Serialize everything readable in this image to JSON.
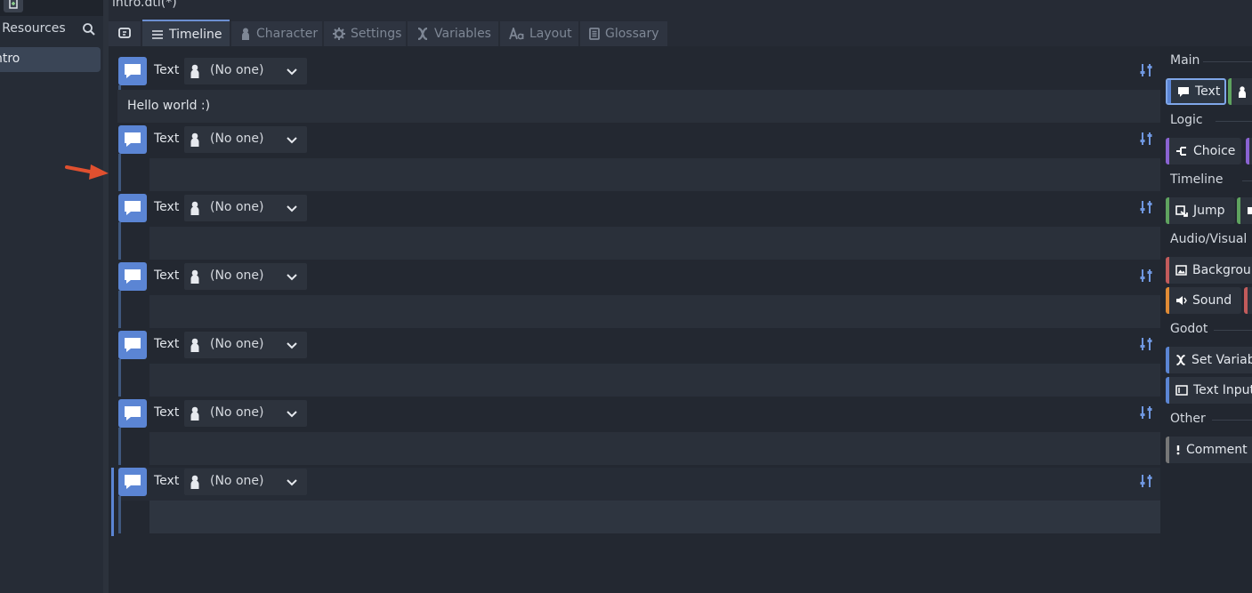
{
  "window": {
    "file_title": "intro.dtl(*)"
  },
  "left_panel": {
    "search_label": "r Resources",
    "items": [
      {
        "label": "ntro"
      }
    ]
  },
  "tabs": [
    {
      "label": "",
      "icon": "dialogic-icon",
      "active": false
    },
    {
      "label": "Timeline",
      "icon": "list-icon",
      "active": true
    },
    {
      "label": "Character",
      "icon": "person-icon",
      "active": false
    },
    {
      "label": "Settings",
      "icon": "gear-icon",
      "active": false
    },
    {
      "label": "Variables",
      "icon": "variable-x-icon",
      "active": false
    },
    {
      "label": "Layout",
      "icon": "font-aa-icon",
      "active": false
    },
    {
      "label": "Glossary",
      "icon": "book-icon",
      "active": false
    }
  ],
  "events": [
    {
      "type": "Text",
      "character": "(No one)",
      "text": "Hello world :)"
    },
    {
      "type": "Text",
      "character": "(No one)",
      "text": ""
    },
    {
      "type": "Text",
      "character": "(No one)",
      "text": ""
    },
    {
      "type": "Text",
      "character": "(No one)",
      "text": ""
    },
    {
      "type": "Text",
      "character": "(No one)",
      "text": ""
    },
    {
      "type": "Text",
      "character": "(No one)",
      "text": ""
    },
    {
      "type": "Text",
      "character": "(No one)",
      "text": ""
    }
  ],
  "right_panel": {
    "sections": [
      {
        "label": "Main",
        "buttons": [
          {
            "label": "Text",
            "color": "#5b85d4",
            "icon": "speech-bubble-icon"
          },
          {
            "label": "",
            "color": "#5fa35f",
            "icon": "person-icon"
          }
        ]
      },
      {
        "label": "Logic",
        "buttons": [
          {
            "label": "Choice",
            "color": "#8a63d2",
            "icon": "branch-icon"
          },
          {
            "label": "",
            "color": "#8a63d2",
            "icon": ""
          }
        ]
      },
      {
        "label": "Timeline",
        "buttons": [
          {
            "label": "Jump",
            "color": "#5fa35f",
            "icon": "jump-icon"
          },
          {
            "label": "",
            "color": "#5fa35f",
            "icon": "label-icon"
          }
        ]
      },
      {
        "label": "Audio/Visual",
        "buttons": [
          {
            "label": "Backgrour",
            "color": "#c25b5b",
            "icon": "image-icon"
          },
          {
            "label": "Sound",
            "color": "#e08b35",
            "icon": "speaker-icon"
          },
          {
            "label": "",
            "color": "#c25b5b",
            "icon": ""
          }
        ]
      },
      {
        "label": "Godot",
        "buttons": [
          {
            "label": "Set Variabl",
            "color": "#5b85d4",
            "icon": "variable-x-icon"
          },
          {
            "label": "Text Input",
            "color": "#5b85d4",
            "icon": "text-input-icon"
          }
        ]
      },
      {
        "label": "Other",
        "buttons": [
          {
            "label": "Comment",
            "color": "#777777",
            "icon": "exclamation-icon"
          }
        ]
      }
    ]
  },
  "colors": {
    "accent": "#5b85d4",
    "selected_border": "#7fa6e8",
    "annotation_arrow": "#e0502f"
  }
}
